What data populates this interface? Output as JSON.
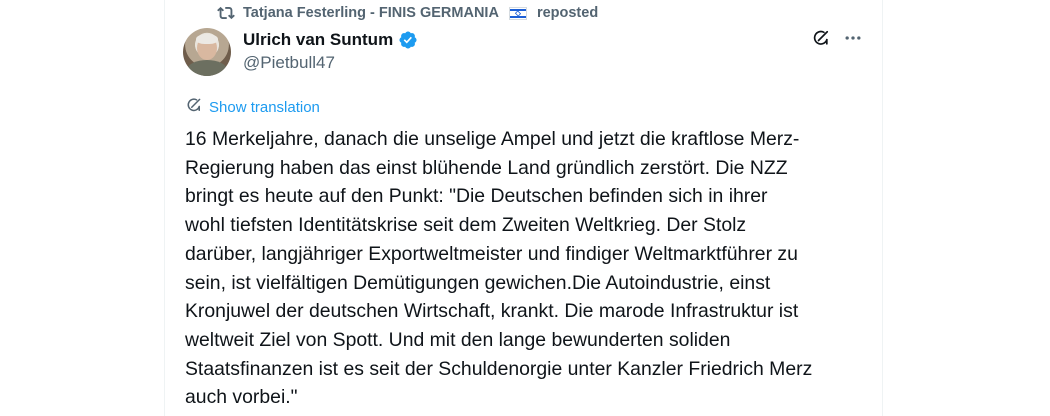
{
  "repost": {
    "text_before_flag": "Tatjana Festerling - FINIS GERMANIA",
    "flag_icon": "israel-flag-icon",
    "text_after_flag": "reposted"
  },
  "author": {
    "name": "Ulrich van Suntum",
    "handle": "@Pietbull47",
    "verified": true
  },
  "actions": {
    "grok_icon": "grok-icon",
    "more_icon": "more-dots-icon"
  },
  "translation": {
    "label": "Show translation"
  },
  "post": {
    "text": "16 Merkeljahre, danach die unselige Ampel und jetzt die kraftlose Merz-\nRegierung haben das einst blühende Land gründlich zerstört. Die NZZ\nbringt es heute auf den Punkt: \"Die Deutschen befinden sich in ihrer\nwohl tiefsten Identitätskrise seit dem Zweiten Weltkrieg. Der Stolz\ndarüber, langjähriger Exportweltmeister und findiger Weltmarktführer zu\nsein, ist vielfältigen Demütigungen gewichen.Die Autoindustrie, einst\nKronjuwel der deutschen Wirtschaft, krankt. Die marode Infrastruktur ist\nweltweit Ziel von Spott. Und mit den lange bewunderten soliden\nStaatsfinanzen ist es seit der Schuldenorgie unter Kanzler Friedrich Merz\nauch vorbei.\""
  },
  "colors": {
    "text_primary": "#0f1419",
    "text_secondary": "#536471",
    "accent": "#1d9bf0",
    "border": "#eff3f4"
  }
}
